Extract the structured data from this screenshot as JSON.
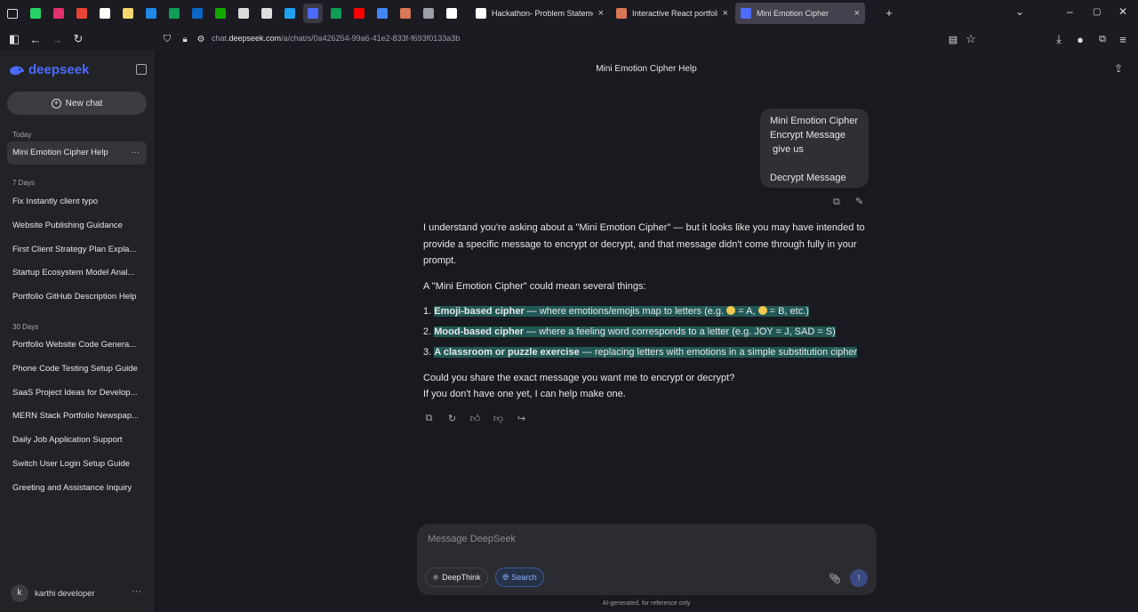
{
  "browser": {
    "pinned_tabs": [
      {
        "icon": "whatsapp-icon",
        "color": "#25d366"
      },
      {
        "icon": "instagram-icon",
        "color": "#e1306c"
      },
      {
        "icon": "gmail-icon",
        "color": "#ea4335"
      },
      {
        "icon": "github-icon",
        "color": "#ffffff"
      },
      {
        "icon": "notes-icon",
        "color": "#f5d76e"
      },
      {
        "icon": "app-icon",
        "color": "#1e88e5"
      },
      {
        "icon": "sheets-icon",
        "color": "#0f9d58"
      },
      {
        "icon": "linkedin-icon",
        "color": "#0a66c2"
      },
      {
        "icon": "upwork-icon",
        "color": "#14a800"
      },
      {
        "icon": "circle-icon",
        "color": "#dddddd"
      },
      {
        "icon": "circle-icon",
        "color": "#dddddd"
      },
      {
        "icon": "vercel-icon",
        "color": "#1da1f2"
      },
      {
        "icon": "deepseek-icon",
        "color": "#4d6bfe"
      },
      {
        "icon": "sheets-icon",
        "color": "#0f9d58"
      },
      {
        "icon": "youtube-icon",
        "color": "#ff0000"
      },
      {
        "icon": "docs-icon",
        "color": "#4285f4"
      },
      {
        "icon": "claude-icon",
        "color": "#d97757"
      },
      {
        "icon": "app-icon",
        "color": "#9aa0a6"
      },
      {
        "icon": "gpt-icon",
        "color": "#ffffff"
      }
    ],
    "tabs": [
      {
        "title": "Hackathon- Problem Statement - E",
        "favicon_color": "#ffffff"
      },
      {
        "title": "Interactive React portfolio web",
        "favicon_color": "#d97757"
      },
      {
        "title": "Mini Emotion Cipher",
        "favicon_color": "#4d6bfe"
      }
    ],
    "url_prefix": "chat.",
    "url_domain": "deepseek.com",
    "url_path": "/a/chat/s/0a426254-99a6-41e2-833f-f693f0133a3b"
  },
  "sidebar": {
    "logo": "deepseek",
    "new_chat": "New chat",
    "group_today": "Today",
    "today": [
      "Mini Emotion Cipher Help"
    ],
    "group_7": "7 Days",
    "seven_days": [
      "Fix Instantly client typo",
      "Website Publishing Guidance",
      "First Client Strategy Plan Expla...",
      "Startup Ecosystem Model Anal...",
      "Portfolio GitHub Description Help"
    ],
    "group_30": "30 Days",
    "thirty_days": [
      "Portfolio Website Code Genera...",
      "Phone Code Testing Setup Guide",
      "SaaS Project Ideas for Develop...",
      "MERN Stack Portfolio Newspap...",
      "Daily Job Application Support",
      "Switch User Login Setup Guide",
      "Greeting and Assistance Inquiry"
    ],
    "user_initial": "k",
    "user_name": "karthi developer"
  },
  "chat": {
    "title": "Mini Emotion Cipher Help",
    "user_message": "Mini Emotion Cipher\nEncrypt Message\n give us\n\nDecrypt Message",
    "answer_p1": "I understand you're asking about a \"Mini Emotion Cipher\" — but it looks like you may have intended to provide a specific message to encrypt or decrypt, and that message didn't come through fully in your prompt.",
    "answer_p2": "A \"Mini Emotion Cipher\" could mean several things:",
    "list": [
      {
        "num": "1.",
        "bold": "Emoji-based cipher",
        "text_a": " — where emotions/emojis map to letters (e.g. ",
        "text_b": " = A, ",
        "text_c": " = B, etc.)"
      },
      {
        "num": "2.",
        "bold": "Mood-based cipher",
        "text": " — where a feeling word corresponds to a letter (e.g. JOY = J, SAD = S)"
      },
      {
        "num": "3.",
        "bold": "A classroom or puzzle exercise",
        "text": " — replacing letters with emotions in a simple substitution cipher"
      }
    ],
    "answer_p3a": "Could you share the exact message you want me to encrypt or decrypt?",
    "answer_p3b": "If you don't have one yet, I can help make one."
  },
  "composer": {
    "placeholder": "Message DeepSeek",
    "deepthink": "DeepThink",
    "search": "Search"
  },
  "disclaimer": "AI-generated, for reference only",
  "colors": {
    "accent": "#4d6bfe",
    "highlight": "#215856"
  }
}
